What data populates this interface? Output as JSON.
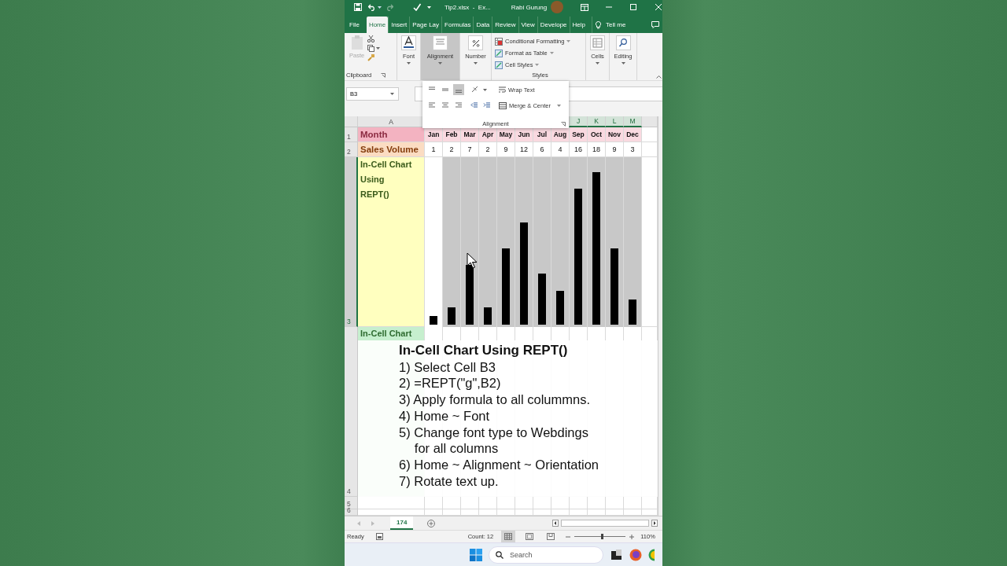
{
  "window": {
    "title": "Tip2.xlsx  -  Ex...",
    "user": "Rabi Gurung"
  },
  "ribbon_tabs": [
    {
      "label": "File",
      "selected": false
    },
    {
      "label": "Home",
      "selected": true
    },
    {
      "label": "Insert",
      "selected": false
    },
    {
      "label": "Page Lay",
      "selected": false
    },
    {
      "label": "Formulas",
      "selected": false
    },
    {
      "label": "Data",
      "selected": false
    },
    {
      "label": "Review",
      "selected": false
    },
    {
      "label": "View",
      "selected": false
    },
    {
      "label": "Develope",
      "selected": false
    },
    {
      "label": "Help",
      "selected": false
    }
  ],
  "tell_me": "Tell me",
  "ribbon_groups": [
    {
      "kind": "clipboard",
      "button": "Paste",
      "label": "Clipboard"
    },
    {
      "kind": "collapsed",
      "label": "Font",
      "pressed": false
    },
    {
      "kind": "collapsed",
      "label": "Alignment",
      "pressed": true
    },
    {
      "kind": "collapsed",
      "label": "Number",
      "pressed": false
    },
    {
      "kind": "styles",
      "items": [
        "Conditional Formatting",
        "Format as Table",
        "Cell Styles"
      ],
      "label": "Styles"
    },
    {
      "kind": "collapsed",
      "label": "Cells",
      "pressed": false
    },
    {
      "kind": "collapsed",
      "label": "Editing",
      "pressed": false
    }
  ],
  "alignment_menu": {
    "wrap_text": "Wrap Text",
    "merge": "Merge & Center",
    "label": "Alignment",
    "vertical_align": [
      {
        "selected": false
      },
      {
        "selected": false
      },
      {
        "selected": true
      }
    ]
  },
  "name_box": "B3",
  "column_headers": [
    "A",
    "J",
    "K",
    "L",
    "M"
  ],
  "rows": [
    {
      "kind": "months",
      "number": "1",
      "label": "Month",
      "cells": [
        "Jan",
        "Feb",
        "Mar",
        "Apr",
        "May",
        "Jun",
        "Jul",
        "Aug",
        "Sep",
        "Oct",
        "Nov",
        "Dec"
      ]
    },
    {
      "kind": "values",
      "number": "2",
      "label": "Sales Volume",
      "cells": [
        "1",
        "2",
        "7",
        "2",
        "9",
        "12",
        "6",
        "4",
        "16",
        "18",
        "9",
        "3"
      ]
    },
    {
      "kind": "chart",
      "number": "3",
      "label": "In-Cell Chart\nUsing\nREPT()",
      "bars": [
        {
          "level": 0.05,
          "active": true
        },
        {
          "level": 0.1,
          "active": false
        },
        {
          "level": 0.35,
          "active": false
        },
        {
          "level": 0.1,
          "active": false
        },
        {
          "level": 0.45,
          "active": false
        },
        {
          "level": 0.6,
          "active": false
        },
        {
          "level": 0.3,
          "active": false
        },
        {
          "level": 0.2,
          "active": false
        },
        {
          "level": 0.8,
          "active": false
        },
        {
          "level": 0.9,
          "active": false
        },
        {
          "level": 0.45,
          "active": false
        },
        {
          "level": 0.15,
          "active": false
        }
      ]
    },
    {
      "kind": "text",
      "number": "4",
      "label": "In-Cell Chart"
    },
    {
      "kind": "empty",
      "number": "5"
    },
    {
      "kind": "empty",
      "number": "6"
    }
  ],
  "caption": {
    "title": "In-Cell Chart Using REPT()",
    "steps": [
      "1) Select Cell B3",
      "2) =REPT(\"g\",B2)",
      "3) Apply formula to all colummns.",
      "4) Home ~ Font",
      "5) Change font type to Webdings\nfor all columns",
      "6) Home ~ Alignment ~ Orientation",
      "7) Rotate text up."
    ]
  },
  "sheet_tabs": [
    {
      "label": "174",
      "selected": true
    }
  ],
  "status_bar": {
    "mode": "Ready",
    "count": "Count: 12",
    "views": [
      {
        "selected": true
      },
      {
        "selected": false
      },
      {
        "selected": false
      }
    ],
    "zoom": {
      "level": 0.52,
      "label": "110%"
    }
  },
  "taskbar": {
    "search": {
      "placeholder": "Search"
    }
  }
}
